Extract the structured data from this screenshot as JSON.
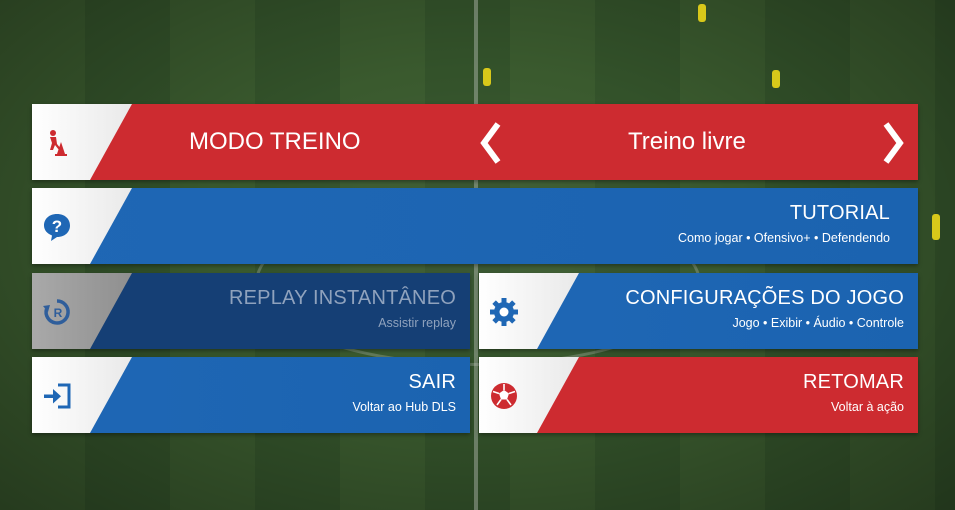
{
  "colors": {
    "red": "#cd2b30",
    "blue": "#1f67b5",
    "dim_blue": "#153f75",
    "white": "#ffffff"
  },
  "mode_bar": {
    "icon": "training-cone-icon",
    "title": "MODO TREINO",
    "prev_icon": "chevron-left-icon",
    "selected_option": "Treino livre",
    "next_icon": "chevron-right-icon"
  },
  "tutorial": {
    "icon": "question-bubble-icon",
    "title": "TUTORIAL",
    "subtitle": "Como jogar • Ofensivo+ • Defendendo"
  },
  "replay": {
    "icon": "replay-icon",
    "title": "REPLAY INSTANTÂNEO",
    "subtitle": "Assistir replay",
    "enabled": false
  },
  "settings": {
    "icon": "gear-icon",
    "title": "CONFIGURAÇÕES DO JOGO",
    "subtitle": "Jogo • Exibir • Áudio • Controle"
  },
  "exit": {
    "icon": "exit-door-icon",
    "title": "SAIR",
    "subtitle": "Voltar ao Hub DLS"
  },
  "resume": {
    "icon": "soccer-ball-icon",
    "title": "RETOMAR",
    "subtitle": "Voltar à ação"
  }
}
